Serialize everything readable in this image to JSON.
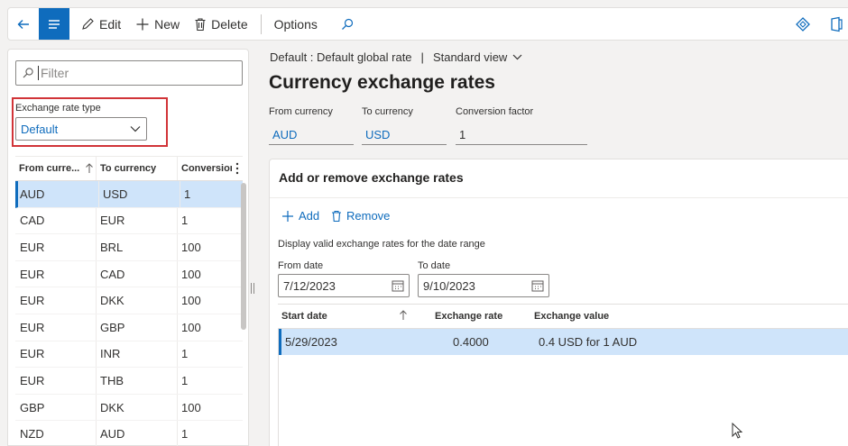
{
  "toolbar": {
    "edit_label": "Edit",
    "new_label": "New",
    "delete_label": "Delete",
    "options_label": "Options"
  },
  "leftpane": {
    "filter_placeholder": "Filter",
    "rate_type_label": "Exchange rate type",
    "rate_type_value": "Default",
    "columns": [
      "From curre...",
      "To currency",
      "Conversion"
    ],
    "rows": [
      [
        "AUD",
        "USD",
        "1"
      ],
      [
        "CAD",
        "EUR",
        "1"
      ],
      [
        "EUR",
        "BRL",
        "100"
      ],
      [
        "EUR",
        "CAD",
        "100"
      ],
      [
        "EUR",
        "DKK",
        "100"
      ],
      [
        "EUR",
        "GBP",
        "100"
      ],
      [
        "EUR",
        "INR",
        "1"
      ],
      [
        "EUR",
        "THB",
        "1"
      ],
      [
        "GBP",
        "DKK",
        "100"
      ],
      [
        "NZD",
        "AUD",
        "1"
      ]
    ]
  },
  "header": {
    "breadcrumb_left": "Default : Default global rate",
    "breadcrumb_sep": "|",
    "view": "Standard view",
    "title": "Currency exchange rates"
  },
  "fields": {
    "from_label": "From currency",
    "from_value": "AUD",
    "to_label": "To currency",
    "to_value": "USD",
    "factor_label": "Conversion factor",
    "factor_value": "1"
  },
  "card": {
    "title": "Add or remove exchange rates",
    "add_label": "Add",
    "remove_label": "Remove",
    "hint": "Display valid exchange rates for the date range",
    "from_date_label": "From date",
    "from_date_value": "7/12/2023",
    "to_date_label": "To date",
    "to_date_value": "9/10/2023",
    "columns": [
      "Start date",
      "Exchange rate",
      "Exchange value"
    ],
    "rows": [
      [
        "5/29/2023",
        "0.4000",
        "0.4 USD for 1 AUD"
      ]
    ]
  },
  "colors": {
    "accent": "#0f6cbd",
    "highlight": "#d13438",
    "selected_row": "#cfe4fa"
  }
}
